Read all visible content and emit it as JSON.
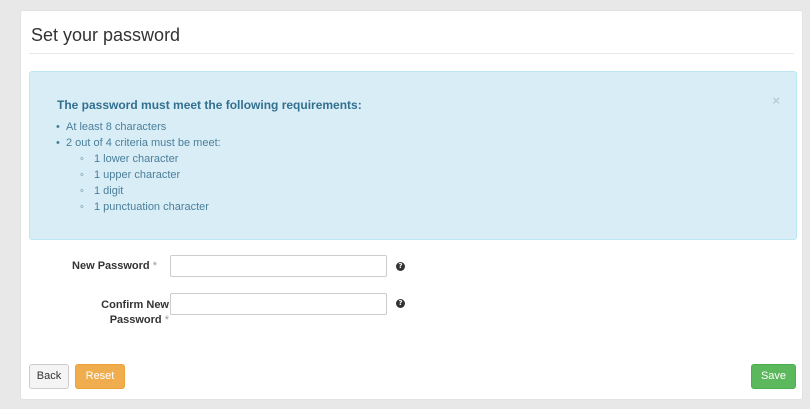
{
  "page": {
    "title": "Set your password"
  },
  "alert": {
    "heading": "The password must meet the following requirements:",
    "close_glyph": "×",
    "requirements": [
      "At least 8 characters",
      "2 out of 4 criteria must be meet:"
    ],
    "criteria": [
      "1 lower character",
      "1 upper character",
      "1 digit",
      "1 punctuation character"
    ]
  },
  "form": {
    "new_password_label": "New Password",
    "confirm_label_line1": "Confirm New",
    "confirm_label_line2": "Password",
    "required_marker": "*",
    "new_password_value": "",
    "confirm_password_value": "",
    "help_glyph": "?"
  },
  "buttons": {
    "back": "Back",
    "reset": "Reset",
    "save": "Save"
  },
  "colors": {
    "alert_bg": "#d9edf7",
    "reset_accent": "#f0ad4e",
    "save_accent": "#5cb85c"
  },
  "icons": {
    "close": "close-icon",
    "help": "question-circle-icon"
  }
}
